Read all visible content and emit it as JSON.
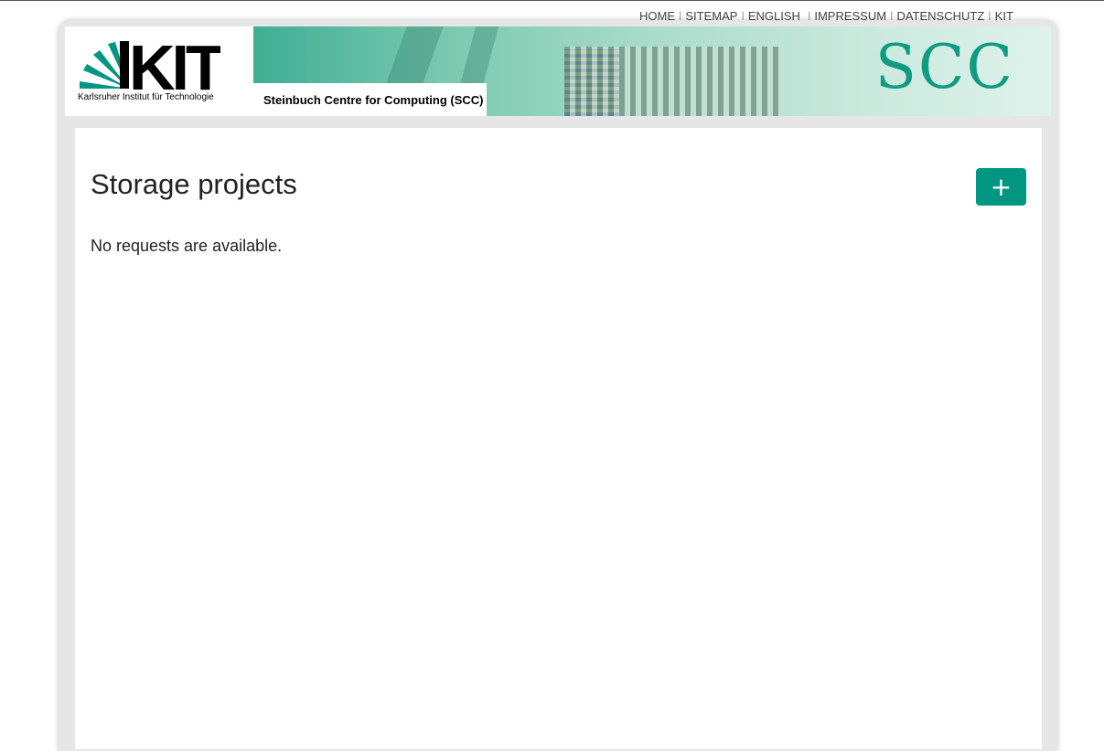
{
  "top_nav": {
    "items": [
      "HOME",
      "SITEMAP",
      "ENGLISH",
      "IMPRESSUM",
      "DATENSCHUTZ",
      "KIT"
    ]
  },
  "header": {
    "kit_logo_text": "KIT",
    "kit_subtitle": "Karlsruher Institut für Technologie",
    "institute_name": "Steinbuch Centre for Computing (SCC)",
    "scc_logo_text": "SCC"
  },
  "main": {
    "title": "Storage projects",
    "add_button_label": "+",
    "empty_message": "No requests are available."
  },
  "colors": {
    "accent": "#009682",
    "text": "#222222"
  }
}
